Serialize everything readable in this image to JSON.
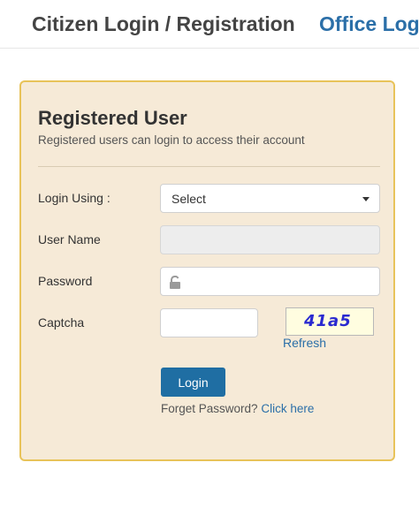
{
  "tabs": {
    "citizen": "Citizen Login / Registration",
    "office": "Office Login"
  },
  "panel": {
    "title": "Registered User",
    "subtitle": "Registered users can login to access their account"
  },
  "form": {
    "login_using_label": "Login Using :",
    "login_using_value": "Select",
    "username_label": "User Name",
    "username_value": "",
    "password_label": "Password",
    "password_value": "",
    "captcha_label": "Captcha",
    "captcha_value": "",
    "captcha_code": "41a5",
    "refresh_label": "Refresh",
    "login_button": "Login",
    "forgot_text": "Forget Password?",
    "click_here": "Click here"
  },
  "icons": {
    "password": "lock-icon",
    "select": "chevron-down-icon"
  },
  "colors": {
    "panel_bg": "#f6ead7",
    "panel_border": "#e8c35a",
    "link": "#2b6fa8",
    "button": "#1f6ea3",
    "captcha_text": "#2a2ad0"
  }
}
